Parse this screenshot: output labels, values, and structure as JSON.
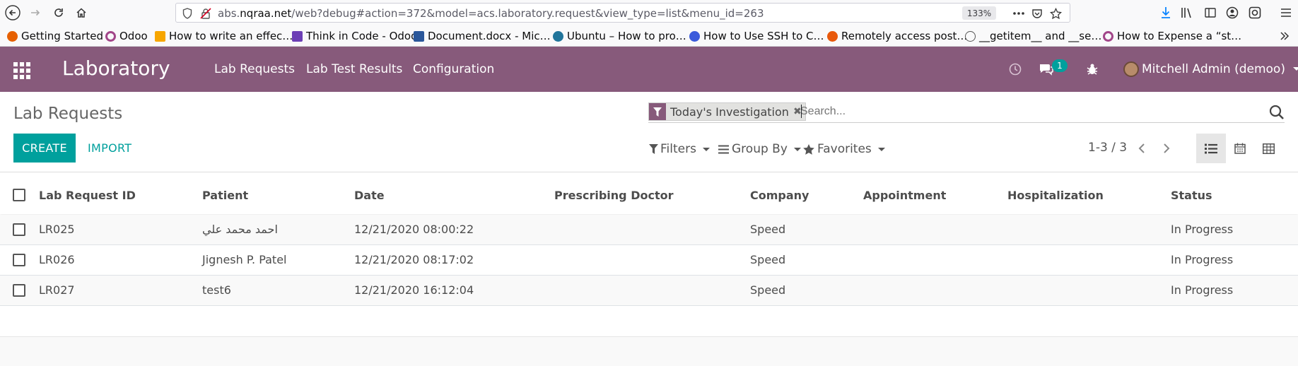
{
  "browser": {
    "url_prefix": "abs.",
    "url_host": "nqraa.net",
    "url_rest": "/web?debug#action=372&model=acs.laboratory.request&view_type=list&menu_id=263",
    "zoom": "133%",
    "bookmarks": [
      {
        "label": "Getting Started",
        "color": "#e66000"
      },
      {
        "label": "Odoo",
        "color": "#a24689"
      },
      {
        "label": "How to write an effec…",
        "color": "#f7a600"
      },
      {
        "label": "Think in Code - Odoo",
        "color": "#6c3fb5"
      },
      {
        "label": "Document.docx - Mic…",
        "color": "#2b579a"
      },
      {
        "label": "Ubuntu – How to pro…",
        "color": "#21759b"
      },
      {
        "label": "How to Use SSH to C…",
        "color": "#3b5bdb"
      },
      {
        "label": "Remotely access post…",
        "color": "#e8590c"
      },
      {
        "label": "__getitem__ and __se…",
        "color": "#555555"
      },
      {
        "label": "How to Expense a “st…",
        "color": "#a24689"
      }
    ]
  },
  "navbar": {
    "brand": "Laboratory",
    "menus": [
      "Lab Requests",
      "Lab Test Results",
      "Configuration"
    ],
    "messages_count": "1",
    "user": "Mitchell Admin (demoo)"
  },
  "control_panel": {
    "title": "Lab Requests",
    "facet": "Today's Investigation",
    "search_placeholder": "Search...",
    "create_label": "CREATE",
    "import_label": "IMPORT",
    "filters_label": "Filters",
    "groupby_label": "Group By",
    "favorites_label": "Favorites",
    "pager": "1-3 / 3"
  },
  "list": {
    "columns": [
      "Lab Request ID",
      "Patient",
      "Date",
      "Prescribing Doctor",
      "Company",
      "Appointment",
      "Hospitalization",
      "Status"
    ],
    "rows": [
      {
        "id": "LR025",
        "patient": "احمد محمد علي",
        "date": "12/21/2020 08:00:22",
        "doctor": "",
        "company": "Speed",
        "appointment": "",
        "hospitalization": "",
        "status": "In Progress"
      },
      {
        "id": "LR026",
        "patient": "Jignesh P. Patel",
        "date": "12/21/2020 08:17:02",
        "doctor": "",
        "company": "Speed",
        "appointment": "",
        "hospitalization": "",
        "status": "In Progress"
      },
      {
        "id": "LR027",
        "patient": "test6",
        "date": "12/21/2020 16:12:04",
        "doctor": "",
        "company": "Speed",
        "appointment": "",
        "hospitalization": "",
        "status": "In Progress"
      }
    ]
  }
}
